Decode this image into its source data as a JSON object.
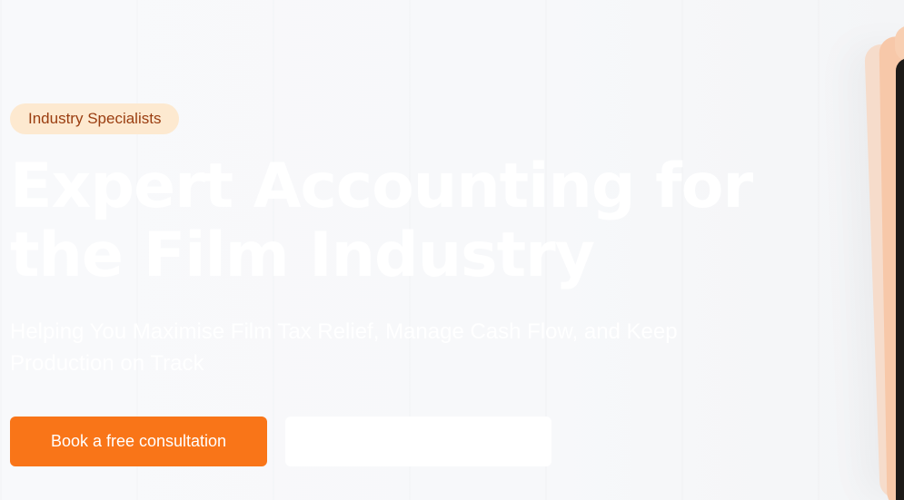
{
  "hero": {
    "badge": "Industry Specialists",
    "headline": "Expert Accounting for the Film Industry",
    "subheadline": "Helping You Maximise Film Tax Relief, Manage Cash Flow, and Keep Production on Track",
    "primary_cta": "Book a free consultation",
    "secondary_cta": ""
  },
  "colors": {
    "accent": "#f97518",
    "badge_bg": "#fde9d0",
    "badge_text": "#9a3d10",
    "background": "#f7f8fa"
  }
}
